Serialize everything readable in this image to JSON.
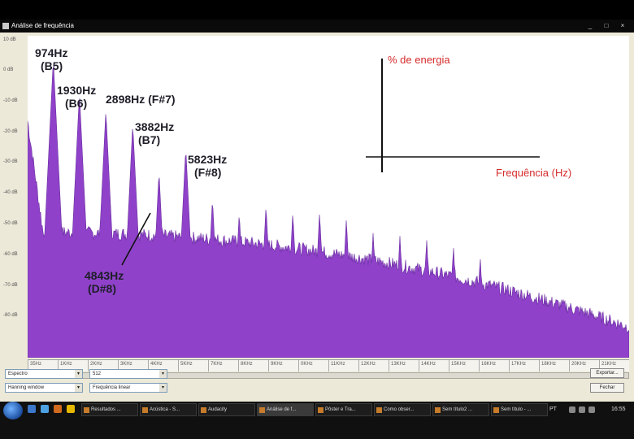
{
  "window": {
    "title": "Análise de frequência",
    "controls": [
      "_",
      "□",
      "×"
    ]
  },
  "plot": {
    "y_labels": [
      "10 dB",
      "0 dB",
      "-10 dB",
      "-20 dB",
      "-30 dB",
      "-40 dB",
      "-50 dB",
      "-60 dB",
      "-70 dB",
      "-80 dB"
    ],
    "x_labels": [
      "35Hz",
      "1KHz",
      "2KHz",
      "3KHz",
      "4KHz",
      "5KHz",
      "7KHz",
      "8KHz",
      "9KHz",
      "0KHz",
      "11KHz",
      "12KHz",
      "13KHz",
      "14KHz",
      "15KHz",
      "16KHz",
      "17KHz",
      "18KHz",
      "20KHz",
      "21KHz"
    ],
    "fill_color": "#8f42c9"
  },
  "annotations": {
    "peak1": [
      "974Hz",
      "(B5)"
    ],
    "peak2": [
      "1930Hz",
      "(B6)"
    ],
    "peak3": "2898Hz (F#7)",
    "peak4": [
      "3882Hz",
      "(B7)"
    ],
    "peak5": [
      "5823Hz",
      "(F#8)"
    ],
    "peak6": [
      "4843Hz",
      "(D#8)"
    ],
    "y_axis_legend": "% de energia",
    "x_axis_legend": "Frequência (Hz)"
  },
  "controls": {
    "algorithm": "Espectro",
    "size": "512",
    "window_fn": "Hanning window",
    "axis": "Frequência linear",
    "export_button": "Exportar...",
    "close_button": "Fechar"
  },
  "taskbar": {
    "items": [
      {
        "label": "Resultados ...",
        "active": false
      },
      {
        "label": "Acústica - S...",
        "active": false
      },
      {
        "label": "Audacity",
        "active": false
      },
      {
        "label": "Análise de f...",
        "active": true
      },
      {
        "label": "Pôster e Tra...",
        "active": false
      },
      {
        "label": "Como obser...",
        "active": false
      },
      {
        "label": "Sem título2 ...",
        "active": false
      },
      {
        "label": "Sem título - ...",
        "active": false
      }
    ],
    "language": "PT",
    "clock": "16:55"
  },
  "chart_data": {
    "type": "area",
    "title": "",
    "xlabel": "Frequência (Hz)",
    "ylabel": "% de energia",
    "xlim": [
      35,
      22050
    ],
    "ylim": [
      -85,
      10
    ],
    "grid": false,
    "series": [
      {
        "peaks_hz": [
          974,
          1930,
          2898,
          3882,
          4843,
          5823,
          6800,
          7780,
          8760,
          9740,
          10720,
          11700,
          12680,
          13660,
          14640,
          15620,
          16600
        ],
        "peaks_db": [
          3,
          -7,
          -12,
          -16,
          -30,
          -23,
          -38,
          -42,
          -40,
          -42,
          -42,
          -44,
          -48,
          -49,
          -50,
          -52,
          -55
        ]
      }
    ]
  }
}
